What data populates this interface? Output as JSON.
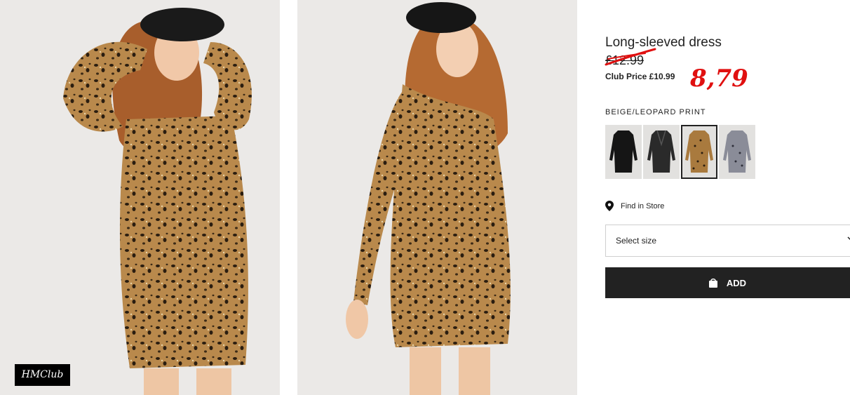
{
  "product": {
    "title": "Long-sleeved dress",
    "old_price": "£12.99",
    "club_price": "Club Price £10.99",
    "annotation_price": "8,79",
    "color_name": "BEIGE/LEOPARD PRINT"
  },
  "badge": {
    "club_logo": "HMClub"
  },
  "swatches": [
    {
      "label": "black",
      "selected": false
    },
    {
      "label": "black-shine",
      "selected": false
    },
    {
      "label": "beige-leopard",
      "selected": true
    },
    {
      "label": "grey-print",
      "selected": false
    }
  ],
  "store": {
    "label": "Find in Store"
  },
  "size": {
    "label": "Select size"
  },
  "cart": {
    "add_label": "ADD"
  },
  "colors": {
    "annotation": "#e01010",
    "button": "#222222",
    "leopard": "#a97a3e"
  }
}
